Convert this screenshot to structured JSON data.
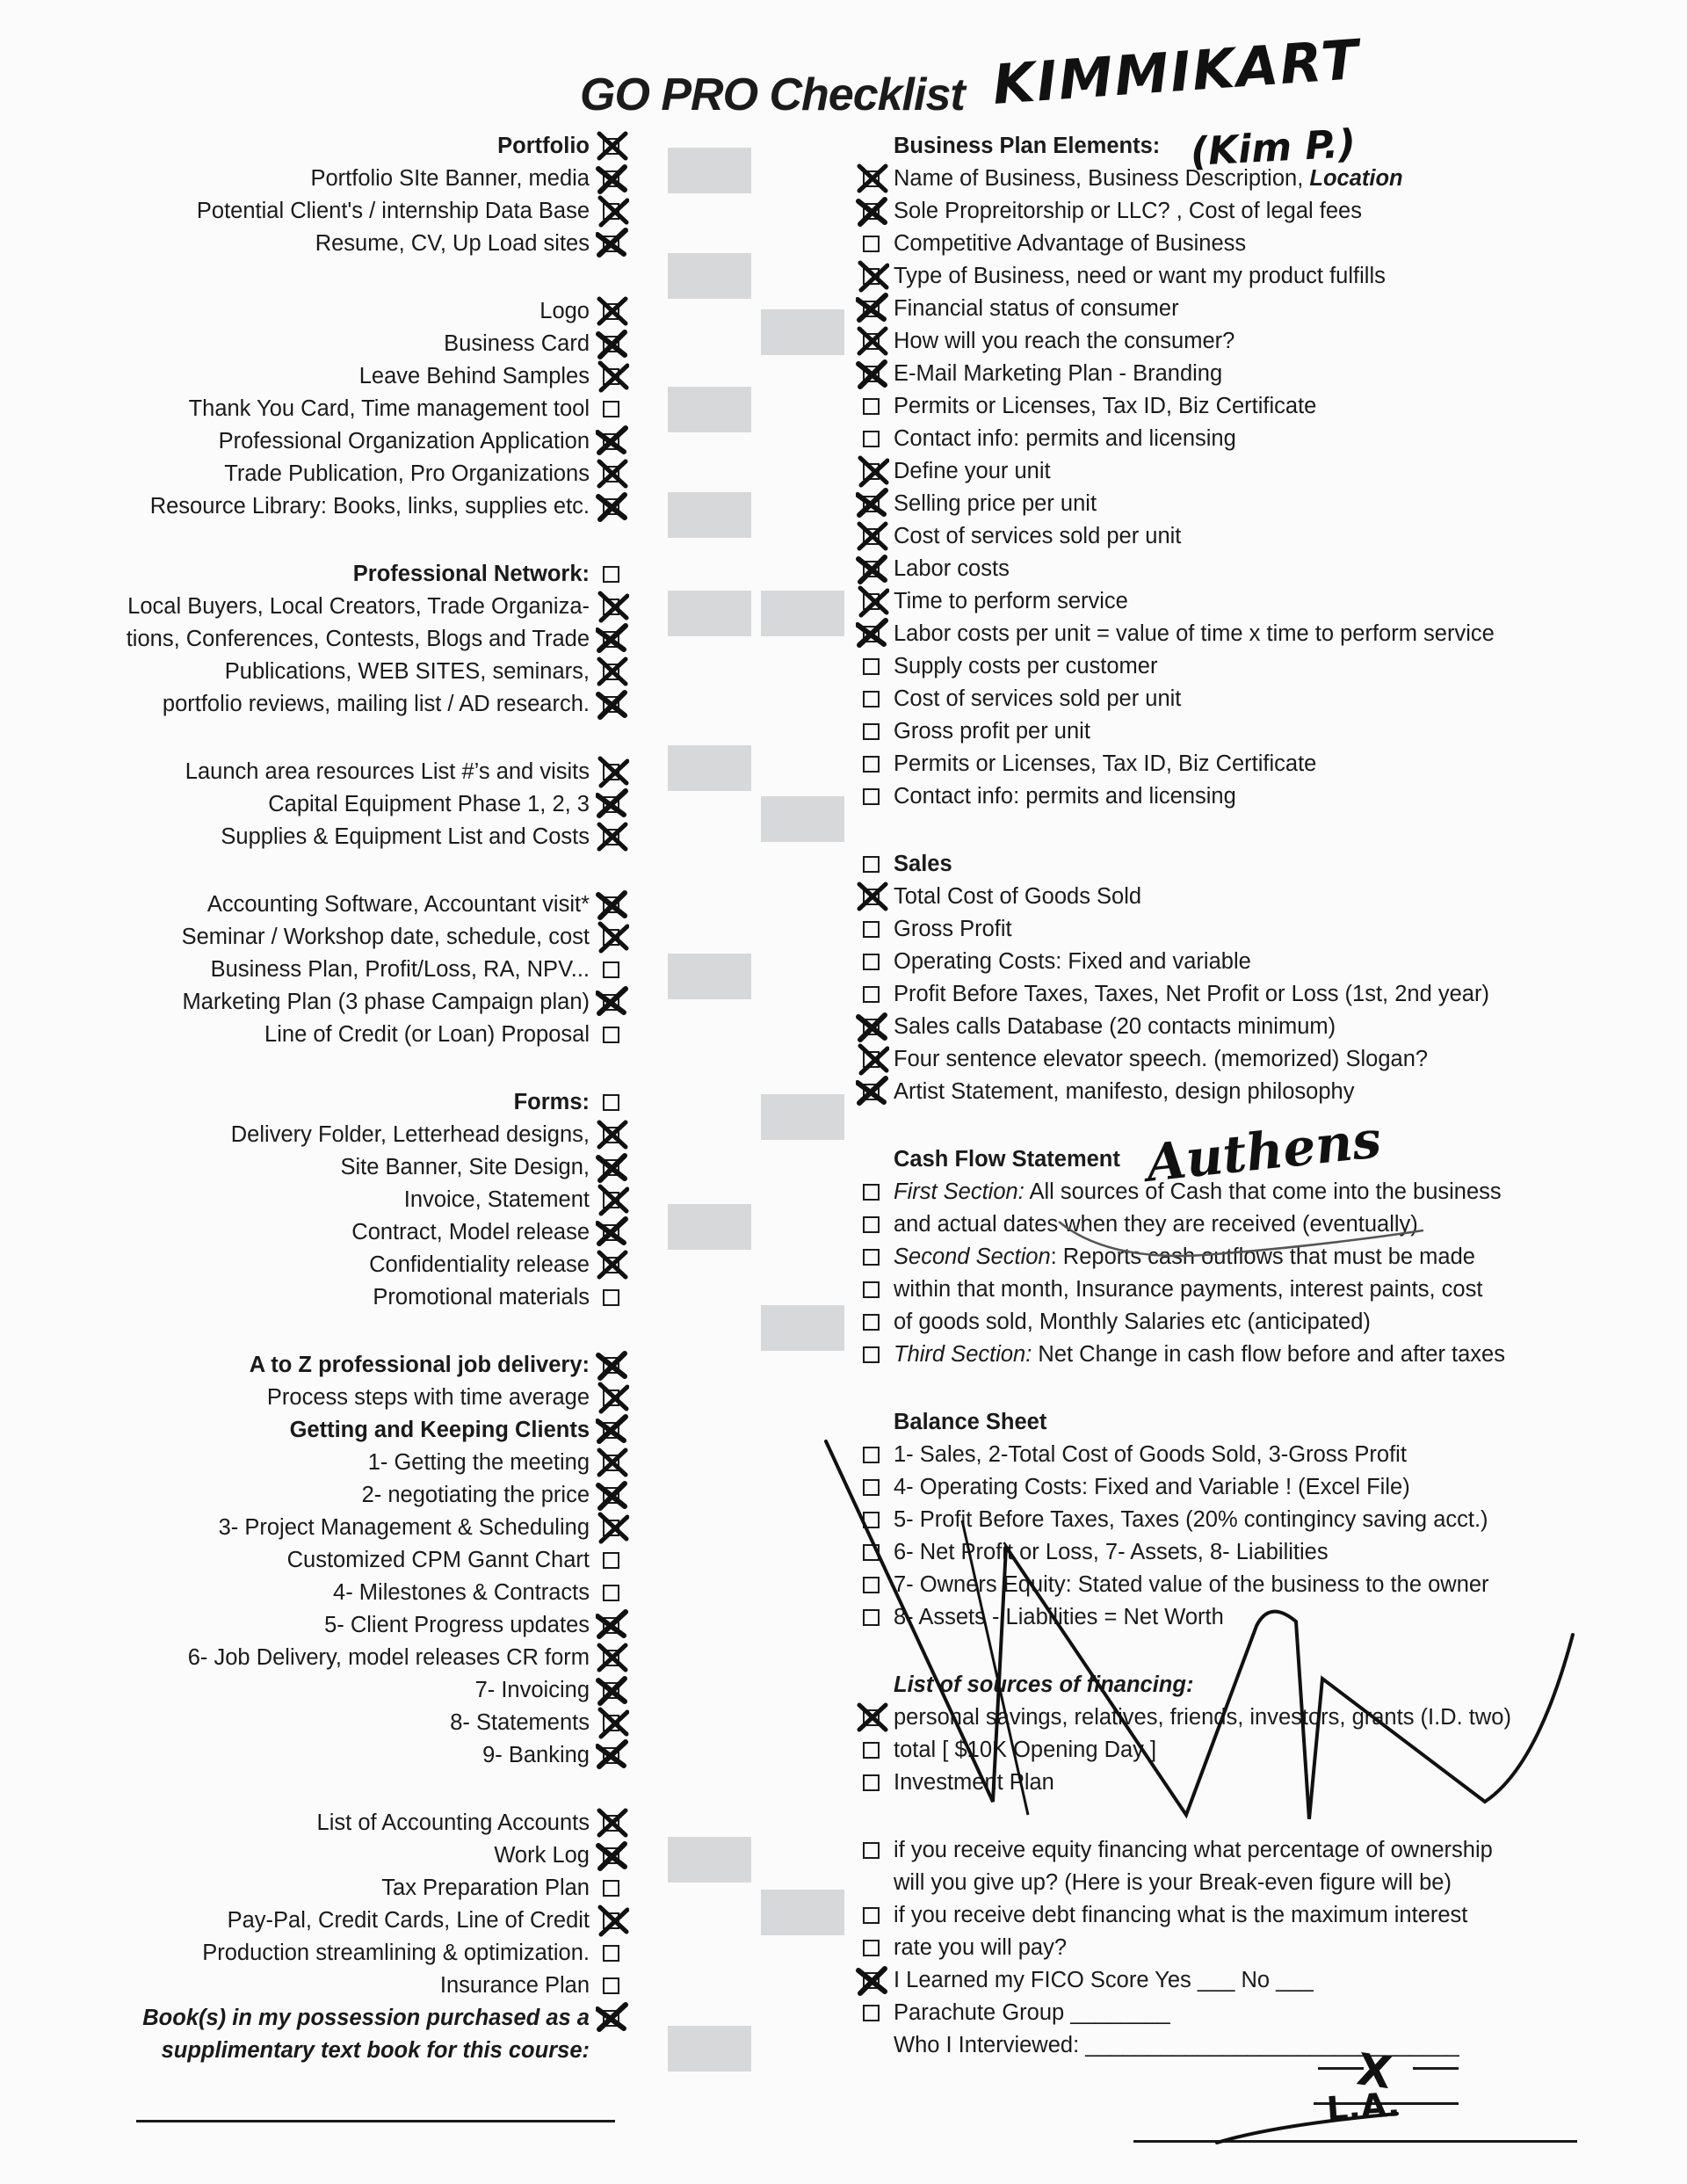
{
  "document": {
    "title": "GO PRO Checklist",
    "handwritten_name": "KIMMIKART",
    "handwritten_alias": "(Kim P.)",
    "handwritten_signature": "Authens",
    "handwritten_parachute_group": "L.A.",
    "handwritten_fico_yes_mark": "X"
  },
  "left_column": {
    "sections": [
      {
        "heading": "Portfolio",
        "heading_checked": true,
        "items": [
          {
            "label": "Portfolio SIte Banner, media",
            "checked": true
          },
          {
            "label": "Potential Client's / internship  Data Base",
            "checked": true
          },
          {
            "label": "Resume, CV, Up Load sites",
            "checked": true
          }
        ]
      },
      {
        "heading": "",
        "items": [
          {
            "label": "Logo",
            "checked": true
          },
          {
            "label": "Business Card",
            "checked": true
          },
          {
            "label": "Leave Behind Samples",
            "checked": true
          },
          {
            "label": "Thank You Card, Time management tool",
            "checked": false
          },
          {
            "label": "Professional Organization Application",
            "checked": true
          },
          {
            "label": "Trade Publication, Pro Organizations",
            "checked": true
          },
          {
            "label": "Resource Library: Books, links, supplies etc.",
            "checked": true
          }
        ]
      },
      {
        "heading": "Professional Network:",
        "heading_checked": false,
        "items": [
          {
            "label": "Local Buyers, Local Creators, Trade Organiza-",
            "checked": true
          },
          {
            "label": "tions, Conferences, Contests, Blogs and Trade",
            "checked": true
          },
          {
            "label": "Publications, WEB SITES, seminars,",
            "checked": true
          },
          {
            "label": "portfolio reviews, mailing list / AD research.",
            "checked": true
          }
        ]
      },
      {
        "heading": "",
        "items": [
          {
            "label": "Launch area resources List #’s and visits",
            "checked": true
          },
          {
            "label": "Capital Equipment Phase 1, 2, 3",
            "checked": true
          },
          {
            "label": "Supplies & Equipment List and Costs",
            "checked": true
          }
        ]
      },
      {
        "heading": "",
        "items": [
          {
            "label": "Accounting Software, Accountant visit*",
            "checked": true
          },
          {
            "label": "Seminar / Workshop date, schedule, cost",
            "checked": true
          },
          {
            "label": "Business Plan, Profit/Loss, RA, NPV...",
            "checked": false
          },
          {
            "label": "Marketing Plan (3 phase Campaign plan)",
            "checked": true
          },
          {
            "label": "Line of Credit (or Loan) Proposal",
            "checked": false
          }
        ]
      },
      {
        "heading": "Forms:",
        "heading_checked": false,
        "items": [
          {
            "label": "Delivery Folder, Letterhead designs,",
            "checked": true
          },
          {
            "label": "Site Banner, Site Design,",
            "checked": true
          },
          {
            "label": "Invoice, Statement",
            "checked": true
          },
          {
            "label": "Contract, Model release",
            "checked": true
          },
          {
            "label": "Confidentiality release",
            "checked": true
          },
          {
            "label": "Promotional materials",
            "checked": false
          }
        ]
      },
      {
        "heading": "A to Z professional job delivery:",
        "heading_checked": true,
        "items": [
          {
            "label": "Process steps with time average",
            "checked": true
          },
          {
            "label": "Getting and Keeping Clients",
            "checked": true,
            "bold": true
          },
          {
            "label": "1- Getting the meeting",
            "checked": true
          },
          {
            "label": "2- negotiating the price",
            "checked": true
          },
          {
            "label": "3- Project Management & Scheduling",
            "checked": true
          },
          {
            "label": "Customized CPM Gannt Chart",
            "checked": false
          },
          {
            "label": "4- Milestones & Contracts",
            "checked": false
          },
          {
            "label": "5- Client Progress updates",
            "checked": true
          },
          {
            "label": "6- Job Delivery, model releases CR form",
            "checked": true
          },
          {
            "label": "7- Invoicing",
            "checked": true
          },
          {
            "label": "8- Statements",
            "checked": true
          },
          {
            "label": "9- Banking",
            "checked": true
          }
        ]
      },
      {
        "heading": "",
        "items": [
          {
            "label": "List of Accounting Accounts",
            "checked": true
          },
          {
            "label": "Work Log",
            "checked": true
          },
          {
            "label": "Tax Preparation Plan",
            "checked": false
          },
          {
            "label": "Pay-Pal, Credit Cards, Line of Credit",
            "checked": true
          },
          {
            "label": "Production streamlining & optimization.",
            "checked": false
          },
          {
            "label": "Insurance Plan",
            "checked": false
          }
        ]
      }
    ],
    "closing": {
      "line1": "Book(s) in my possession purchased as a",
      "line2": "supplimentary text book for this course:",
      "checked": true
    }
  },
  "right_column": {
    "sections": [
      {
        "heading": "Business Plan Elements:",
        "items": [
          {
            "label": "Name of Business, Business Description, ",
            "label_italic": "Location",
            "checked": true
          },
          {
            "label": "Sole Propreitorship or LLC? , Cost of legal fees",
            "checked": true
          },
          {
            "label": "Competitive Advantage of Business",
            "checked": false
          },
          {
            "label": "Type of Business, need or want my product fulfills",
            "checked": true
          },
          {
            "label": "Financial status of consumer",
            "checked": true
          },
          {
            "label": "How will you reach the consumer?",
            "checked": true
          },
          {
            "label": "E-Mail Marketing Plan - Branding",
            "checked": true
          },
          {
            "label": "Permits or Licenses, Tax ID, Biz Certificate",
            "checked": false
          },
          {
            "label": "Contact info:  permits and licensing",
            "checked": false
          },
          {
            "label": "Define your unit",
            "checked": true
          },
          {
            "label": "Selling price per unit",
            "checked": true
          },
          {
            "label": "Cost of services sold per unit",
            "checked": true
          },
          {
            "label": "Labor costs",
            "checked": true
          },
          {
            "label": "Time to perform service",
            "checked": true
          },
          {
            "label": "Labor costs per unit = value of time x time to perform service",
            "checked": true
          },
          {
            "label": "Supply costs per customer",
            "checked": false
          },
          {
            "label": "Cost of services sold per unit",
            "checked": false
          },
          {
            "label": "Gross profit per unit",
            "checked": false
          },
          {
            "label": "Permits or Licenses, Tax ID, Biz Certificate",
            "checked": false
          },
          {
            "label": "Contact info:  permits and licensing",
            "checked": false
          }
        ]
      },
      {
        "heading": "",
        "items": [
          {
            "label": "Sales",
            "checked": false,
            "bold": true
          },
          {
            "label": "Total Cost of Goods Sold",
            "checked": true
          },
          {
            "label": "Gross Profit",
            "checked": false
          },
          {
            "label": "Operating Costs: Fixed and variable",
            "checked": false
          },
          {
            "label": "Profit Before Taxes, Taxes, Net Profit or Loss (1st, 2nd year)",
            "checked": false
          },
          {
            "label": "Sales calls Database (20 contacts minimum)",
            "checked": true
          },
          {
            "label": "Four sentence elevator speech. (memorized) Slogan?",
            "checked": true
          },
          {
            "label": "Artist Statement, manifesto, design philosophy",
            "checked": true
          }
        ]
      },
      {
        "heading": "Cash Flow Statement",
        "items": [
          {
            "label": "First Section:",
            "label_rest": " All sources of Cash that come into the business",
            "italic_lead": true,
            "checked": false
          },
          {
            "label": "and actual dates when they are received (eventually)",
            "checked": false
          },
          {
            "label": "Second Section",
            "label_rest": ": Reports cash outflows that must be made",
            "italic_lead": true,
            "checked": false
          },
          {
            "label": "within that month, Insurance payments, interest paints, cost",
            "checked": false
          },
          {
            "label": "of goods sold, Monthly Salaries etc (anticipated)",
            "checked": false
          },
          {
            "label": "Third Section:",
            "label_rest": " Net Change in cash flow before and after taxes",
            "italic_lead": true,
            "checked": false
          }
        ]
      },
      {
        "heading": "Balance Sheet",
        "items": [
          {
            "label": "1- Sales, 2-Total Cost of Goods Sold, 3-Gross Profit",
            "checked": false
          },
          {
            "label": "4- Operating Costs: Fixed and Variable ! (Excel File)",
            "checked": false
          },
          {
            "label": "5- Profit Before Taxes, Taxes (20% contingincy saving acct.)",
            "checked": false
          },
          {
            "label": "6- Net Profit or Loss, 7- Assets, 8- Liabilities",
            "checked": false
          },
          {
            "label": "7- Owners Equity: Stated value of the business to the owner",
            "checked": false
          },
          {
            "label": "8- Assets - Liabilities = Net Worth",
            "checked": false
          }
        ]
      },
      {
        "heading": "List of sources of financing:",
        "heading_italic": true,
        "items": [
          {
            "label": "personal savings, relatives, friends, investors, grants (I.D. two)",
            "checked": true
          },
          {
            "label": "total  [ $10K Opening Day ]",
            "checked": false
          },
          {
            "label": "Investment Plan",
            "checked": false
          }
        ]
      },
      {
        "heading": "",
        "items": [
          {
            "label": "if you receive equity financing what percentage of ownership",
            "checked": false
          },
          {
            "label": "will you give up? (Here is your Break-even figure will be)",
            "checked": false,
            "no_box": true
          },
          {
            "label": "if you receive debt financing what is the maximum interest",
            "checked": false
          },
          {
            "label": "rate you will pay?",
            "checked": false
          },
          {
            "label": "I Learned my FICO Score  Yes ___ No ___",
            "checked": true
          },
          {
            "label": "Parachute Group ________",
            "checked": false
          },
          {
            "label": "Who I Interviewed: ______________________________",
            "checked": false,
            "no_box": true
          }
        ]
      }
    ]
  }
}
